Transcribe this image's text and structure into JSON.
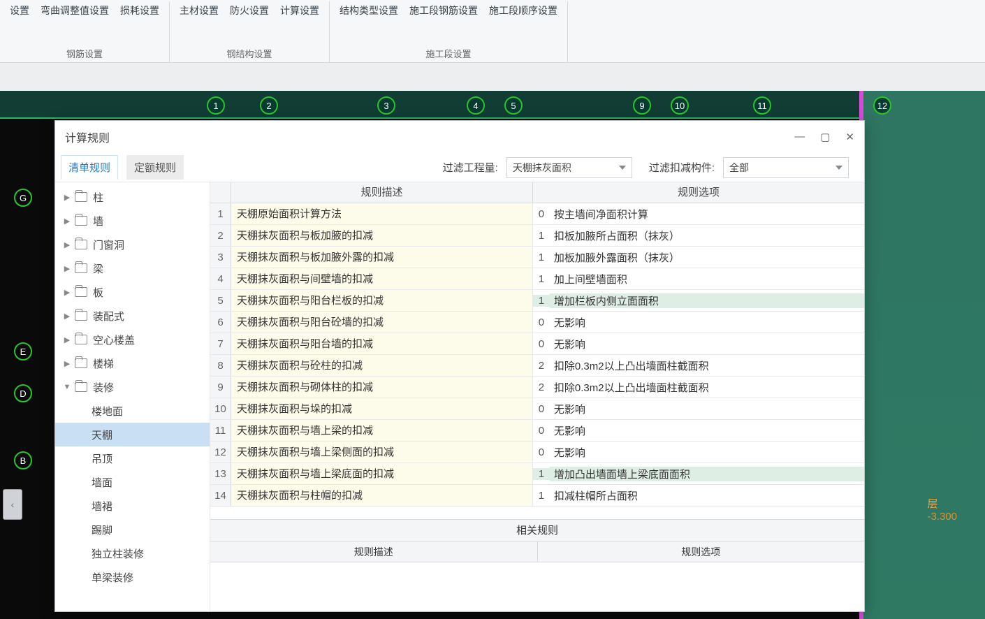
{
  "ribbon": {
    "groups": [
      {
        "buttons": [
          "设置",
          "弯曲调整值设置",
          "损耗设置"
        ],
        "caption": "钢筋设置"
      },
      {
        "buttons": [
          "主材设置",
          "防火设置",
          "计算设置"
        ],
        "caption": "钢结构设置"
      },
      {
        "buttons": [
          "结构类型设置",
          "施工段钢筋设置",
          "施工段顺序设置"
        ],
        "caption": "施工段设置"
      }
    ]
  },
  "cad": {
    "topNumbers": [
      "1",
      "2",
      "3",
      "4",
      "5",
      "9",
      "10",
      "11",
      "12"
    ],
    "leftLetters": [
      "G",
      "E",
      "D",
      "B"
    ],
    "level": "层",
    "elev": "-3.300"
  },
  "sideBtnGlyph": "‹",
  "modal": {
    "title": "计算规则",
    "win": {
      "min": "―",
      "max": "▢",
      "close": "✕"
    },
    "tabs": {
      "list": "清单规则",
      "quota": "定额规则"
    },
    "filter1_label": "过滤工程量:",
    "filter1_value": "天棚抹灰面积",
    "filter2_label": "过滤扣减构件:",
    "filter2_value": "全部",
    "tree": {
      "folders": [
        "柱",
        "墙",
        "门窗洞",
        "梁",
        "板",
        "装配式",
        "空心楼盖",
        "楼梯"
      ],
      "openFolder": "装修",
      "leaves": [
        "楼地面",
        "天棚",
        "吊顶",
        "墙面",
        "墙裙",
        "踢脚",
        "独立柱装修",
        "单梁装修"
      ],
      "selected": "天棚"
    },
    "grid": {
      "hd_desc": "规则描述",
      "hd_opt": "规则选项",
      "related": "相关规则",
      "rows": [
        {
          "n": "1",
          "d": "天棚原始面积计算方法",
          "i": "0",
          "o": "按主墙间净面积计算"
        },
        {
          "n": "2",
          "d": "天棚抹灰面积与板加腋的扣减",
          "i": "1",
          "o": "扣板加腋所占面积（抹灰）"
        },
        {
          "n": "3",
          "d": "天棚抹灰面积与板加腋外露的扣减",
          "i": "1",
          "o": "加板加腋外露面积（抹灰）"
        },
        {
          "n": "4",
          "d": "天棚抹灰面积与间壁墙的扣减",
          "i": "1",
          "o": "加上间壁墙面积"
        },
        {
          "n": "5",
          "d": "天棚抹灰面积与阳台栏板的扣减",
          "i": "1",
          "o": "增加栏板内侧立面面积",
          "hl": true
        },
        {
          "n": "6",
          "d": "天棚抹灰面积与阳台砼墙的扣减",
          "i": "0",
          "o": " 无影响"
        },
        {
          "n": "7",
          "d": "天棚抹灰面积与阳台墙的扣减",
          "i": "0",
          "o": " 无影响"
        },
        {
          "n": "8",
          "d": "天棚抹灰面积与砼柱的扣减",
          "i": "2",
          "o": "扣除0.3m2以上凸出墙面柱截面积"
        },
        {
          "n": "9",
          "d": "天棚抹灰面积与砌体柱的扣减",
          "i": "2",
          "o": "扣除0.3m2以上凸出墙面柱截面积"
        },
        {
          "n": "10",
          "d": "天棚抹灰面积与垛的扣减",
          "i": "0",
          "o": " 无影响"
        },
        {
          "n": "11",
          "d": "天棚抹灰面积与墙上梁的扣减",
          "i": "0",
          "o": " 无影响"
        },
        {
          "n": "12",
          "d": "天棚抹灰面积与墙上梁侧面的扣减",
          "i": "0",
          "o": " 无影响"
        },
        {
          "n": "13",
          "d": "天棚抹灰面积与墙上梁底面的扣减",
          "i": "1",
          "o": "增加凸出墙面墙上梁底面面积",
          "hl": true
        },
        {
          "n": "14",
          "d": "天棚抹灰面积与柱帽的扣减",
          "i": "1",
          "o": "扣减柱帽所占面积"
        }
      ]
    }
  }
}
